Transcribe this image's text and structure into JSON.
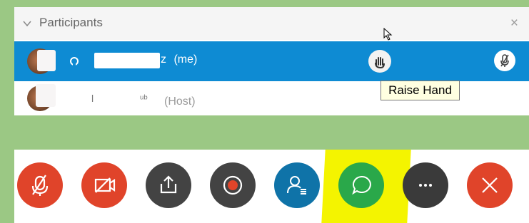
{
  "participants_panel": {
    "title": "Participants",
    "close_glyph": "×",
    "rows": [
      {
        "name_suffix": "z",
        "tag": "(me)"
      },
      {
        "name_part1": "l",
        "name_part2": "ᵘᵇ",
        "tag": "(Host)"
      }
    ]
  },
  "tooltip": {
    "text": "Raise Hand"
  },
  "toolbar": {
    "buttons": [
      {
        "name": "mute",
        "icon": "mic-off-icon",
        "color": "#e0442a"
      },
      {
        "name": "video",
        "icon": "video-off-icon",
        "color": "#e0442a"
      },
      {
        "name": "share",
        "icon": "share-icon",
        "color": "#434343"
      },
      {
        "name": "record",
        "icon": "record-icon",
        "color": "#434343"
      },
      {
        "name": "participants",
        "icon": "participants-icon",
        "color": "#0f73a8"
      },
      {
        "name": "chat",
        "icon": "chat-icon",
        "color": "#2aa84a"
      },
      {
        "name": "more",
        "icon": "more-icon",
        "color": "#3a3a3a"
      },
      {
        "name": "leave",
        "icon": "close-icon",
        "color": "#e0442a"
      }
    ]
  },
  "colors": {
    "background": "#9bc884",
    "selected_row": "#0e8bd3",
    "highlight": "#f4f400"
  }
}
